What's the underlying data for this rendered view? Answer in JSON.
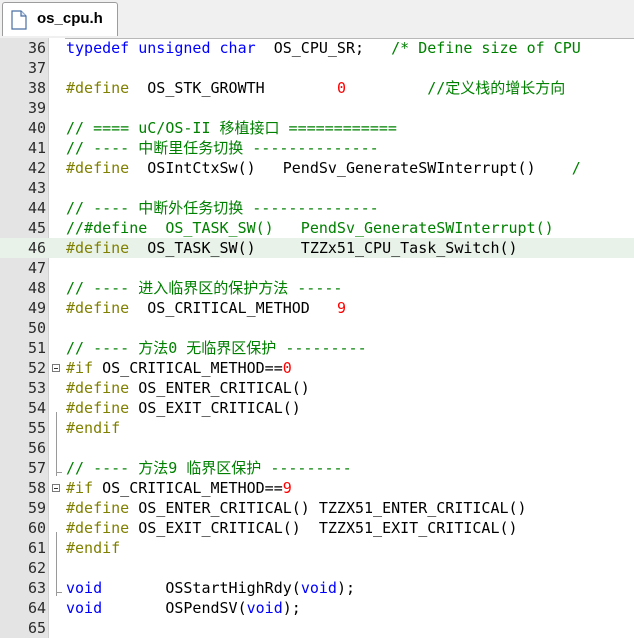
{
  "tab": {
    "title": "os_cpu.h",
    "icon": "file-icon"
  },
  "colors": {
    "directive": "#808000",
    "keyword": "#0000ff",
    "comment": "#008000",
    "number": "#ff0000",
    "text": "#000000",
    "highlight": "#e8f2e8"
  },
  "lines": [
    {
      "n": "36",
      "segs": [
        {
          "c": "kw",
          "t": "typedef"
        },
        {
          "c": "tx",
          "t": " "
        },
        {
          "c": "kw",
          "t": "unsigned"
        },
        {
          "c": "tx",
          "t": " "
        },
        {
          "c": "kw",
          "t": "char"
        },
        {
          "c": "tx",
          "t": "  OS_CPU_SR;   "
        },
        {
          "c": "cm",
          "t": "/* Define size of CPU"
        }
      ]
    },
    {
      "n": "37",
      "segs": []
    },
    {
      "n": "38",
      "segs": [
        {
          "c": "dir",
          "t": "#define"
        },
        {
          "c": "tx",
          "t": "  OS_STK_GROWTH        "
        },
        {
          "c": "nm",
          "t": "0"
        },
        {
          "c": "tx",
          "t": "         "
        },
        {
          "c": "cm",
          "t": "//定义栈的增长方向"
        }
      ]
    },
    {
      "n": "39",
      "segs": []
    },
    {
      "n": "40",
      "segs": [
        {
          "c": "cm",
          "t": "// ==== uC/OS-II 移植接口 ============"
        }
      ]
    },
    {
      "n": "41",
      "segs": [
        {
          "c": "cm",
          "t": "// ---- 中断里任务切换 --------------"
        }
      ]
    },
    {
      "n": "42",
      "segs": [
        {
          "c": "dir",
          "t": "#define"
        },
        {
          "c": "tx",
          "t": "  OSIntCtxSw()   PendSv_GenerateSWInterrupt()    "
        },
        {
          "c": "cm",
          "t": "/"
        }
      ]
    },
    {
      "n": "43",
      "segs": []
    },
    {
      "n": "44",
      "segs": [
        {
          "c": "cm",
          "t": "// ---- 中断外任务切换 --------------"
        }
      ]
    },
    {
      "n": "45",
      "segs": [
        {
          "c": "cm",
          "t": "//#define  OS_TASK_SW()   PendSv_GenerateSWInterrupt()"
        }
      ]
    },
    {
      "n": "46",
      "hl": true,
      "segs": [
        {
          "c": "dir",
          "t": "#define"
        },
        {
          "c": "tx",
          "t": "  OS_TASK_SW()     TZZx51_CPU_Task_Switch()"
        }
      ]
    },
    {
      "n": "47",
      "segs": []
    },
    {
      "n": "48",
      "segs": [
        {
          "c": "cm",
          "t": "// ---- 进入临界区的保护方法 -----"
        }
      ]
    },
    {
      "n": "49",
      "segs": [
        {
          "c": "dir",
          "t": "#define"
        },
        {
          "c": "tx",
          "t": "  OS_CRITICAL_METHOD   "
        },
        {
          "c": "nm",
          "t": "9"
        }
      ]
    },
    {
      "n": "50",
      "segs": []
    },
    {
      "n": "51",
      "segs": [
        {
          "c": "cm",
          "t": "// ---- 方法0 无临界区保护 ---------"
        }
      ]
    },
    {
      "n": "52",
      "fold": true,
      "segs": [
        {
          "c": "dir",
          "t": "#if"
        },
        {
          "c": "tx",
          "t": " OS_CRITICAL_METHOD=="
        },
        {
          "c": "nm",
          "t": "0"
        }
      ]
    },
    {
      "n": "53",
      "segs": [
        {
          "c": "dir",
          "t": "#define"
        },
        {
          "c": "tx",
          "t": " OS_ENTER_CRITICAL()"
        }
      ]
    },
    {
      "n": "54",
      "segs": [
        {
          "c": "dir",
          "t": "#define"
        },
        {
          "c": "tx",
          "t": " OS_EXIT_CRITICAL()"
        }
      ]
    },
    {
      "n": "55",
      "segs": [
        {
          "c": "dir",
          "t": "#endif"
        }
      ]
    },
    {
      "n": "56",
      "segs": []
    },
    {
      "n": "57",
      "segs": [
        {
          "c": "cm",
          "t": "// ---- 方法9 临界区保护 ---------"
        }
      ]
    },
    {
      "n": "58",
      "fold": true,
      "segs": [
        {
          "c": "dir",
          "t": "#if"
        },
        {
          "c": "tx",
          "t": " OS_CRITICAL_METHOD=="
        },
        {
          "c": "nm",
          "t": "9"
        }
      ]
    },
    {
      "n": "59",
      "segs": [
        {
          "c": "dir",
          "t": "#define"
        },
        {
          "c": "tx",
          "t": " OS_ENTER_CRITICAL() TZZX51_ENTER_CRITICAL()"
        }
      ]
    },
    {
      "n": "60",
      "segs": [
        {
          "c": "dir",
          "t": "#define"
        },
        {
          "c": "tx",
          "t": " OS_EXIT_CRITICAL()  TZZX51_EXIT_CRITICAL()"
        }
      ]
    },
    {
      "n": "61",
      "segs": [
        {
          "c": "dir",
          "t": "#endif"
        }
      ]
    },
    {
      "n": "62",
      "segs": []
    },
    {
      "n": "63",
      "segs": [
        {
          "c": "kw",
          "t": "void"
        },
        {
          "c": "tx",
          "t": "       OSStartHighRdy("
        },
        {
          "c": "kw",
          "t": "void"
        },
        {
          "c": "tx",
          "t": ");"
        }
      ]
    },
    {
      "n": "64",
      "segs": [
        {
          "c": "kw",
          "t": "void"
        },
        {
          "c": "tx",
          "t": "       OSPendSV("
        },
        {
          "c": "kw",
          "t": "void"
        },
        {
          "c": "tx",
          "t": ");"
        }
      ]
    },
    {
      "n": "65",
      "segs": []
    }
  ]
}
